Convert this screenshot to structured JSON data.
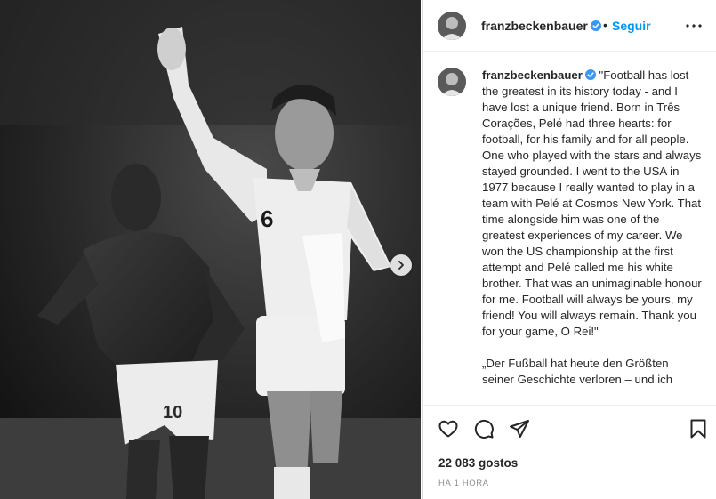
{
  "post": {
    "username": "franzbeckenbauer",
    "separator": "•",
    "follow_label": "Seguir",
    "more_icon": "more-horizontal-icon",
    "verified_icon": "verified-badge-icon",
    "colors": {
      "link": "#0095f6",
      "verified": "#3897f0",
      "text": "#262626",
      "muted": "#8e8e8e"
    }
  },
  "caption": {
    "username": "franzbeckenbauer",
    "paragraph_1": "\"Football has lost the greatest in its history today - and I have lost a unique friend. Born in Três Corações, Pelé had three hearts: for football, for his family and for all people. One who played with the stars and always stayed grounded. I went to the USA in 1977 because I really wanted to play in a team with Pelé at Cosmos New York. That time alongside him was one of the greatest experiences of my career. We won the US championship at the first attempt and Pelé called me his white brother. That was an unimaginable honour for me. Football will always be yours, my friend! You will always remain. Thank you for your game, O Rei!\"",
    "paragraph_2": "„Der Fußball hat heute den Größten seiner Geschichte verloren – und ich"
  },
  "photo": {
    "jersey_left": "10",
    "jersey_right": "6"
  },
  "actions": {
    "like_icon": "heart-icon",
    "comment_icon": "comment-icon",
    "share_icon": "share-icon",
    "save_icon": "bookmark-icon",
    "next_icon": "chevron-right-icon"
  },
  "stats": {
    "likes": "22 083 gostos",
    "time": "HÁ 1 HORA"
  }
}
